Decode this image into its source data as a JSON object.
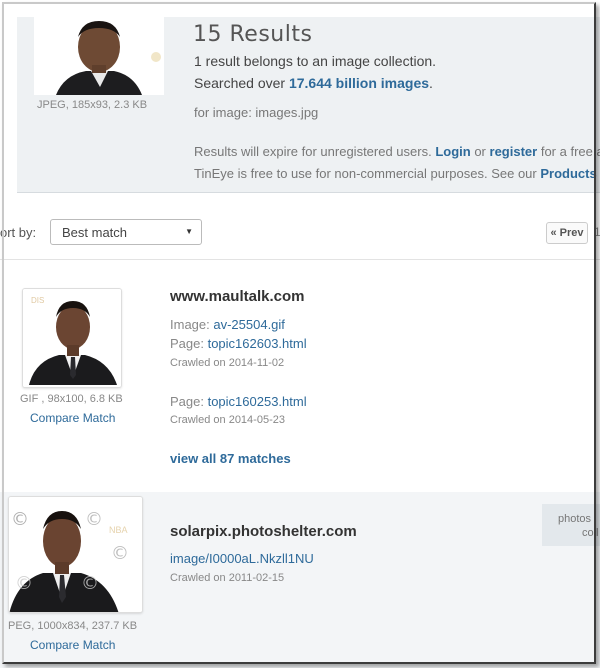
{
  "query": {
    "meta": "JPEG, 185x93, 2.3 KB",
    "for_image_label": "for image: images.jpg"
  },
  "summary": {
    "title": "15 Results",
    "collection_line": "1 result belongs to an image collection.",
    "searched_prefix": "Searched over ",
    "searched_count": "17.644 billion images",
    "searched_suffix": ".",
    "notice1_prefix": "Results will expire for unregistered users. ",
    "login": "Login",
    "or": " or ",
    "register": "register",
    "notice1_suffix": " for a free acc",
    "notice2_prefix": "TinEye is free to use for non-commercial purposes. See our ",
    "products": "Products an"
  },
  "sort": {
    "label": "ort by:",
    "selected": "Best match",
    "prev": "« Prev",
    "page_hint": "1"
  },
  "results": [
    {
      "thumb_meta": "GIF , 98x100, 6.8 KB",
      "compare": "Compare Match",
      "domain": "www.maultalk.com",
      "image_label": "Image: ",
      "image_link": "av-25504.gif",
      "page_label": "Page: ",
      "page_link": "topic162603.html",
      "crawled": "Crawled on 2014-11-02",
      "page2_label": "Page: ",
      "page2_link": "topic160253.html",
      "crawled2": "Crawled on 2014-05-23",
      "view_all": "view all 87 matches"
    },
    {
      "thumb_meta": "PEG, 1000x834, 237.7 KB",
      "compare": "Compare Match",
      "domain": "solarpix.photoshelter.com",
      "image_link": "image/I0000aL.Nkzll1NU",
      "crawled": "Crawled on 2011-02-15",
      "collection_l1": "photos",
      "collection_l2": "coll"
    }
  ],
  "colors": {
    "link": "#2e6a9a",
    "header_bg": "#eef1f3",
    "result2_bg": "#f3f5f7"
  },
  "icons": {
    "sort_caret": "▼",
    "copyright": "©"
  }
}
